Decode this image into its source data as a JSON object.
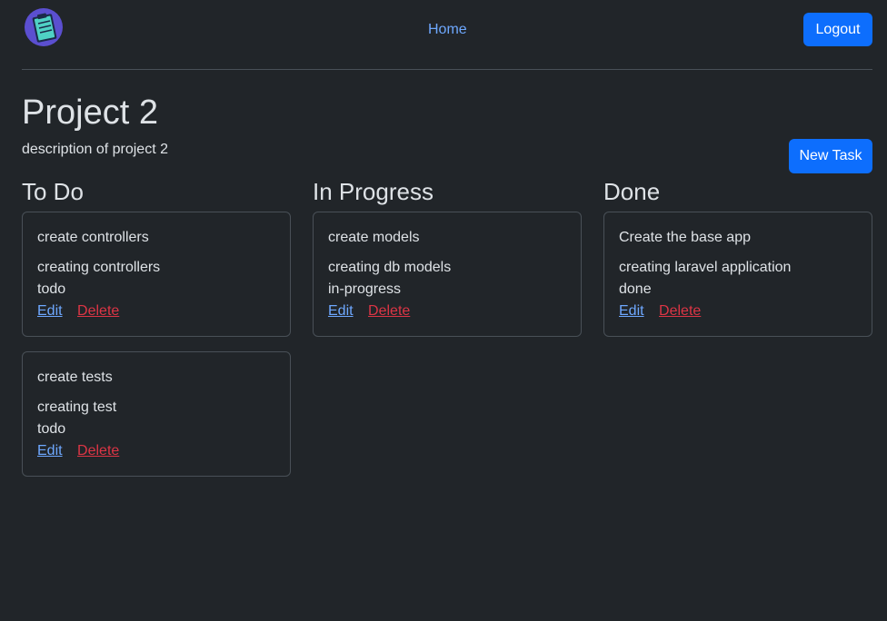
{
  "nav": {
    "home_label": "Home",
    "logout_label": "Logout"
  },
  "project": {
    "title": "Project 2",
    "description": "description of project 2",
    "new_task_label": "New Task"
  },
  "columns": [
    {
      "title": "To Do",
      "tasks": [
        {
          "title": "create controllers",
          "description": "creating controllers",
          "status": "todo",
          "edit_label": "Edit",
          "delete_label": "Delete"
        },
        {
          "title": "create tests",
          "description": "creating test",
          "status": "todo",
          "edit_label": "Edit",
          "delete_label": "Delete"
        }
      ]
    },
    {
      "title": "In Progress",
      "tasks": [
        {
          "title": "create models",
          "description": "creating db models",
          "status": "in-progress",
          "edit_label": "Edit",
          "delete_label": "Delete"
        }
      ]
    },
    {
      "title": "Done",
      "tasks": [
        {
          "title": "Create the base app",
          "description": "creating laravel application",
          "status": "done",
          "edit_label": "Edit",
          "delete_label": "Delete"
        }
      ]
    }
  ],
  "icons": {
    "logo": "clipboard-logo-icon"
  },
  "colors": {
    "background": "#212529",
    "primary": "#0d6efd",
    "link": "#6ea8fe",
    "danger": "#dc3545",
    "border": "#495057"
  }
}
